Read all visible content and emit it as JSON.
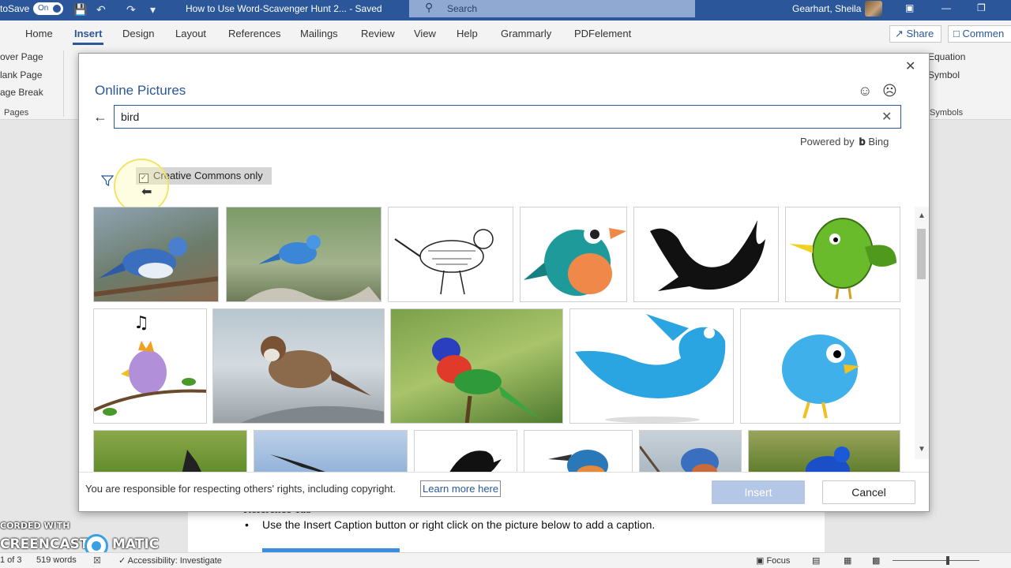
{
  "titlebar": {
    "autosave_label": "toSave",
    "autosave_state": "On",
    "doc_title": "How to Use Word-Scavenger Hunt 2... - Saved",
    "search_placeholder": "Search",
    "user_name": "Gearhart, Sheila"
  },
  "tabs": [
    "Home",
    "Insert",
    "Design",
    "Layout",
    "References",
    "Mailings",
    "Review",
    "View",
    "Help",
    "Grammarly",
    "PDFelement"
  ],
  "active_tab": "Insert",
  "share_label": "Share",
  "comments_label": "Commen",
  "ribbon": {
    "pages_items": [
      "over Page",
      "lank Page",
      "age Break"
    ],
    "pages_group": "Pages",
    "symbols_items": [
      "Equation",
      "Symbol"
    ],
    "symbols_group": "Symbols"
  },
  "dialog": {
    "title": "Online Pictures",
    "search_value": "bird",
    "powered_by": "Powered by",
    "powered_brand": "Bing",
    "creative_commons_label": "Creative Commons only",
    "creative_commons_checked": true,
    "results": [
      {
        "name": "blue jay photo",
        "kind": "photo"
      },
      {
        "name": "bluebird photo",
        "kind": "photo"
      },
      {
        "name": "bird line drawing",
        "kind": "drawing"
      },
      {
        "name": "teal cartoon bird",
        "kind": "cartoon"
      },
      {
        "name": "black bird silhouette",
        "kind": "silhouette"
      },
      {
        "name": "green cartoon bird",
        "kind": "cartoon"
      },
      {
        "name": "purple singing bird",
        "kind": "cartoon"
      },
      {
        "name": "sparrow photo",
        "kind": "photo"
      },
      {
        "name": "lorikeet photo",
        "kind": "photo"
      },
      {
        "name": "twitter style bird",
        "kind": "logo"
      },
      {
        "name": "fluffy blue bird",
        "kind": "cartoon"
      },
      {
        "name": "crested bird photo",
        "kind": "photo"
      },
      {
        "name": "bird in flight photo",
        "kind": "photo"
      },
      {
        "name": "black bird silhouette small",
        "kind": "silhouette"
      },
      {
        "name": "kingfisher illustration",
        "kind": "drawing"
      },
      {
        "name": "eastern bluebird photo",
        "kind": "photo"
      },
      {
        "name": "indigo bunting photo",
        "kind": "photo"
      }
    ],
    "disclaimer": "You are responsible for respecting others' rights, including copyright.",
    "learn_more": "Learn more here",
    "insert_label": "Insert",
    "cancel_label": "Cancel"
  },
  "document": {
    "heading": "Reference Tab",
    "bullet": "Use the Insert Caption button or right click on the picture below to add a caption."
  },
  "watermark": {
    "line1": "CORDED WITH",
    "line2a": "CREENCAST",
    "line2b": "MATIC"
  },
  "statusbar": {
    "page": "1 of 3",
    "words": "519 words",
    "accessibility": "Accessibility: Investigate",
    "focus": "Focus"
  },
  "colors": {
    "accent": "#2b579a",
    "insert_disabled": "#b4c7e7"
  }
}
